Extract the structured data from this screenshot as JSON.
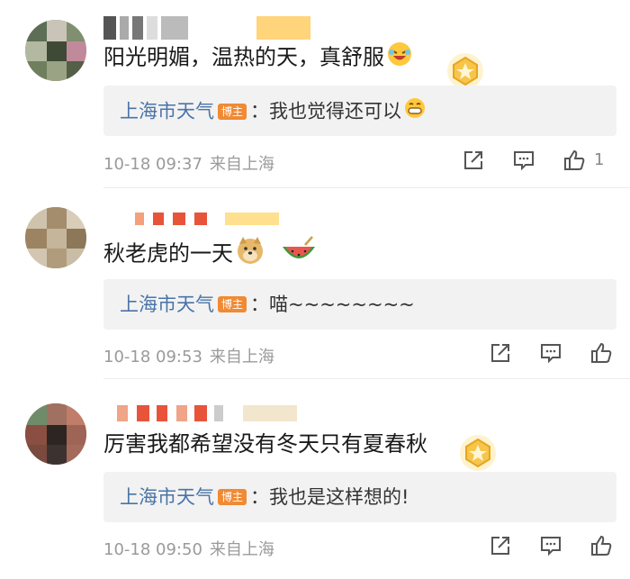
{
  "comments": [
    {
      "text": "阳光明媚，温热的天，真舒服",
      "reply": {
        "author": "上海市天气",
        "tag": "博主",
        "colon": "：",
        "text": "我也觉得还可以"
      },
      "time": "10-18 09:37",
      "source": "来自上海",
      "likes": "1"
    },
    {
      "text": "秋老虎的一天",
      "reply": {
        "author": "上海市天气",
        "tag": "博主",
        "colon": "：",
        "text": "喵~~~~~~~~"
      },
      "time": "10-18 09:53",
      "source": "来自上海",
      "likes": ""
    },
    {
      "text": "厉害我都希望没有冬天只有夏春秋",
      "reply": {
        "author": "上海市天气",
        "tag": "博主",
        "colon": "：",
        "text": "我也是这样想的!"
      },
      "time": "10-18 09:50",
      "source": "来自上海",
      "likes": ""
    }
  ],
  "icons": {
    "share": "share-icon",
    "comment": "comment-icon",
    "like": "thumbs-up-icon",
    "laugh_emoji": "laughing-emoji-icon",
    "grin_emoji": "grinning-emoji-icon",
    "doge_emoji": "doge-emoji-icon",
    "watermelon_emoji": "watermelon-emoji-icon",
    "star_badge": "star-badge-icon"
  },
  "colors": {
    "author_link": "#4a74a8",
    "blogger_tag": "#f08a34",
    "reply_bg": "#f2f2f2",
    "meta_text": "#9a9a9a"
  }
}
